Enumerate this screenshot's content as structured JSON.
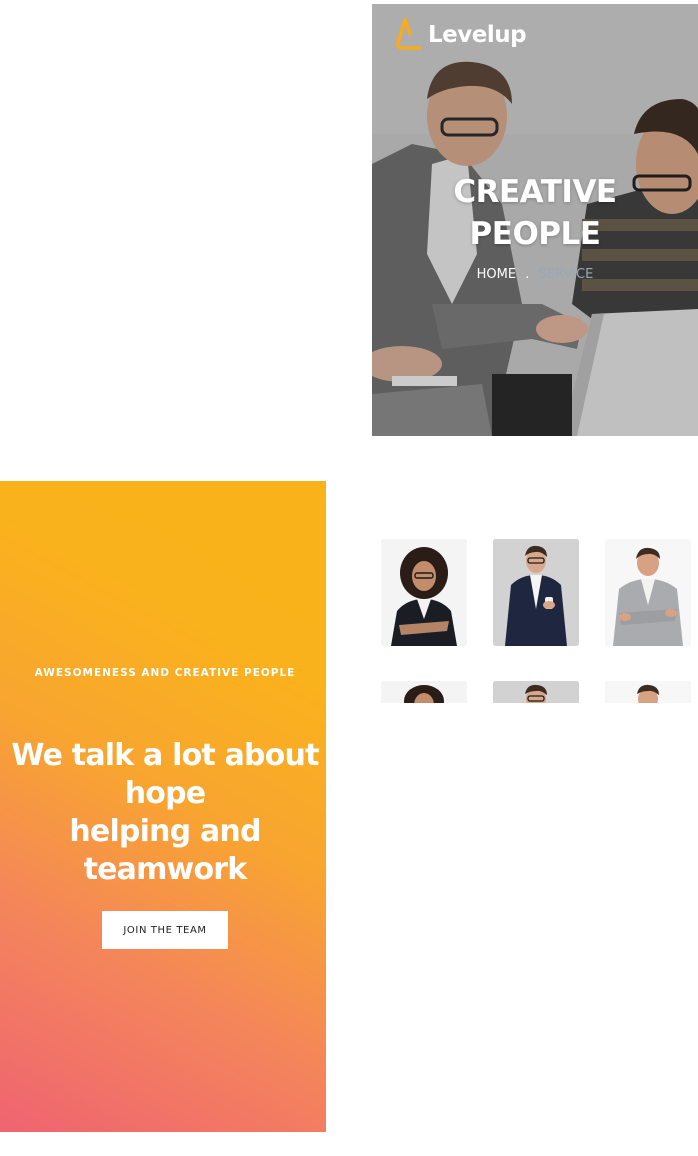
{
  "header": {
    "logo_text": "Levelup",
    "brand_color": "#f8ab1c"
  },
  "hero": {
    "title_line1": "CREATIVE",
    "title_line2": "PEOPLE",
    "breadcrumb": {
      "home": "HOME",
      "separator": ".",
      "current": "SERVICE"
    }
  },
  "promo": {
    "kicker": "AWESOMENESS AND CREATIVE PEOPLE",
    "heading_lines": [
      "We talk a lot about",
      "hope",
      "helping and",
      "teamwork"
    ],
    "button_label": "JOIN THE TEAM",
    "gradient": [
      "#ef6471",
      "#fab21c"
    ]
  },
  "team": {
    "members": [
      {
        "icon": "woman-curly-hair-portrait"
      },
      {
        "icon": "man-navy-suit-portrait"
      },
      {
        "icon": "man-grey-blazer-portrait"
      },
      {
        "icon": "woman-curly-hair-portrait"
      },
      {
        "icon": "man-navy-suit-portrait"
      },
      {
        "icon": "man-grey-blazer-portrait"
      }
    ]
  }
}
